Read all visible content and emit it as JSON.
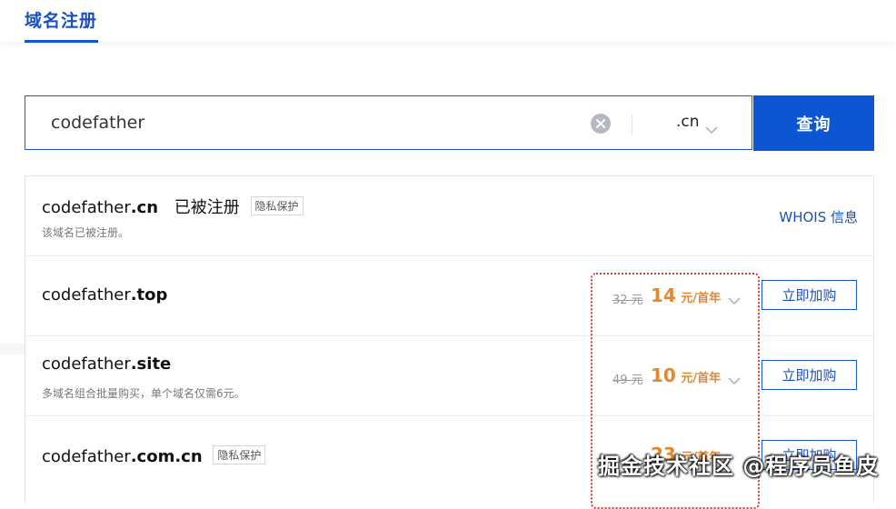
{
  "header": {
    "active_tab": "域名注册"
  },
  "search": {
    "value": "codefather",
    "tld": ".cn",
    "button_label": "查询"
  },
  "results": [
    {
      "name": "codefather",
      "tld": ".cn",
      "status": "已被注册",
      "badge": "隐私保护",
      "note": "该域名已被注册。",
      "action": "WHOIS 信息"
    },
    {
      "name": "codefather",
      "tld": ".top",
      "old_price": "32 元",
      "price": "14",
      "unit": "元/首年",
      "action": "立即加购"
    },
    {
      "name": "codefather",
      "tld": ".site",
      "note": "多域名组合批量购买，单个域名仅需6元。",
      "old_price": "49 元",
      "price": "10",
      "unit": "元/首年",
      "action": "立即加购"
    },
    {
      "name": "codefather",
      "tld": ".com.cn",
      "badge": "隐私保护",
      "price": "23",
      "unit": "元/首年",
      "action": "立即加购"
    }
  ],
  "watermark": "掘金技术社区 @程序员鱼皮",
  "colors": {
    "accent": "#0c56d4",
    "price": "#e8862a",
    "highlight_border": "#c84040"
  }
}
